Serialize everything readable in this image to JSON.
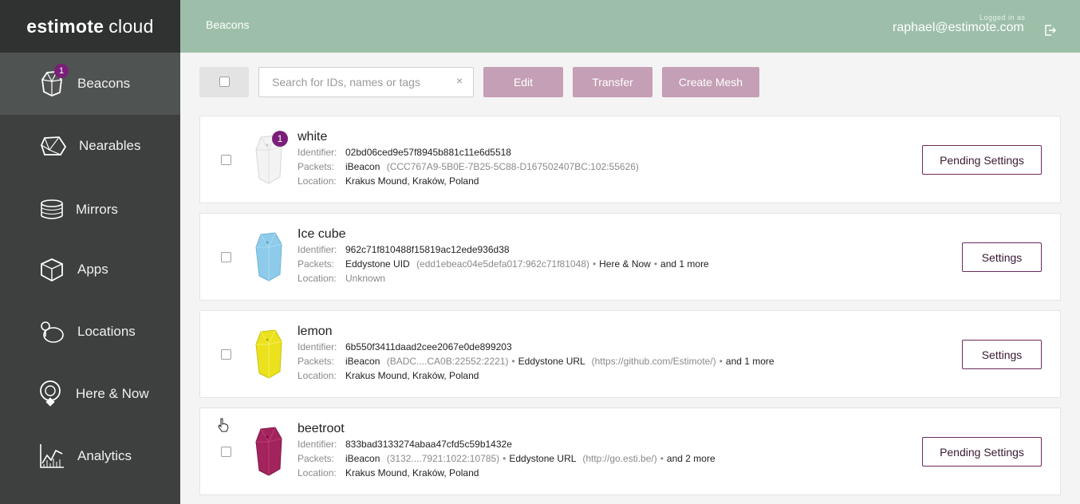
{
  "brand": {
    "bold": "estimote",
    "thin": "cloud"
  },
  "sidebar": {
    "items": [
      {
        "label": "Beacons",
        "badge": "1",
        "icon": "beacon-icon"
      },
      {
        "label": "Nearables",
        "icon": "nearable-icon"
      },
      {
        "label": "Mirrors",
        "icon": "mirror-icon"
      },
      {
        "label": "Apps",
        "icon": "app-box-icon"
      },
      {
        "label": "Locations",
        "icon": "location-icon"
      },
      {
        "label": "Here & Now",
        "icon": "here-now-icon"
      },
      {
        "label": "Analytics",
        "icon": "analytics-icon"
      }
    ]
  },
  "header": {
    "breadcrumb": "Beacons",
    "logged_in_label": "Logged in as",
    "user_email": "raphael@estimote.com"
  },
  "toolbar": {
    "search_placeholder": "Search for IDs, names or tags",
    "clear": "×",
    "edit": "Edit",
    "transfer": "Transfer",
    "create_mesh": "Create Mesh"
  },
  "labels": {
    "identifier": "Identifier:",
    "packets": "Packets:",
    "location": "Location:"
  },
  "beacons": [
    {
      "name": "white",
      "badge": "1",
      "color": "#f2f2f2",
      "identifier": "02bd06ced9e57f8945b881c11e6d5518",
      "packet1": "iBeacon",
      "packet1_detail": "(CCC767A9-5B0E-7B25-5C88-D167502407BC:102:55626)",
      "packet2": "",
      "packet2_detail": "",
      "extra": "",
      "location": "Krakus Mound, Kraków, Poland",
      "location_muted": false,
      "button": "Pending Settings"
    },
    {
      "name": "Ice cube",
      "color": "#8ecbea",
      "identifier": "962c71f810488f15819ac12ede936d38",
      "packet1": "Eddystone UID",
      "packet1_detail": "(edd1ebeac04e5defa017:962c71f81048)",
      "packet2": "Here & Now",
      "packet2_detail": "",
      "extra": "and 1 more",
      "location": "Unknown",
      "location_muted": true,
      "button": "Settings"
    },
    {
      "name": "lemon",
      "color": "#ebe21d",
      "identifier": "6b550f3411daad2cee2067e0de899203",
      "packet1": "iBeacon",
      "packet1_detail": "(BADC....CA0B:22552:2221)",
      "packet2": "Eddystone URL",
      "packet2_detail": "(https://github.com/Estimote/)",
      "extra": "and 1 more",
      "location": "Krakus Mound, Kraków, Poland",
      "location_muted": false,
      "button": "Settings"
    },
    {
      "name": "beetroot",
      "color": "#a3245d",
      "identifier": "833bad3133274abaa47cfd5c59b1432e",
      "packet1": "iBeacon",
      "packet1_detail": "(3132....7921:1022:10785)",
      "packet2": "Eddystone URL",
      "packet2_detail": "(http://go.esti.be/)",
      "extra": "and 2 more",
      "location": "Krakus Mound, Kraków, Poland",
      "location_muted": false,
      "button": "Pending Settings"
    }
  ]
}
